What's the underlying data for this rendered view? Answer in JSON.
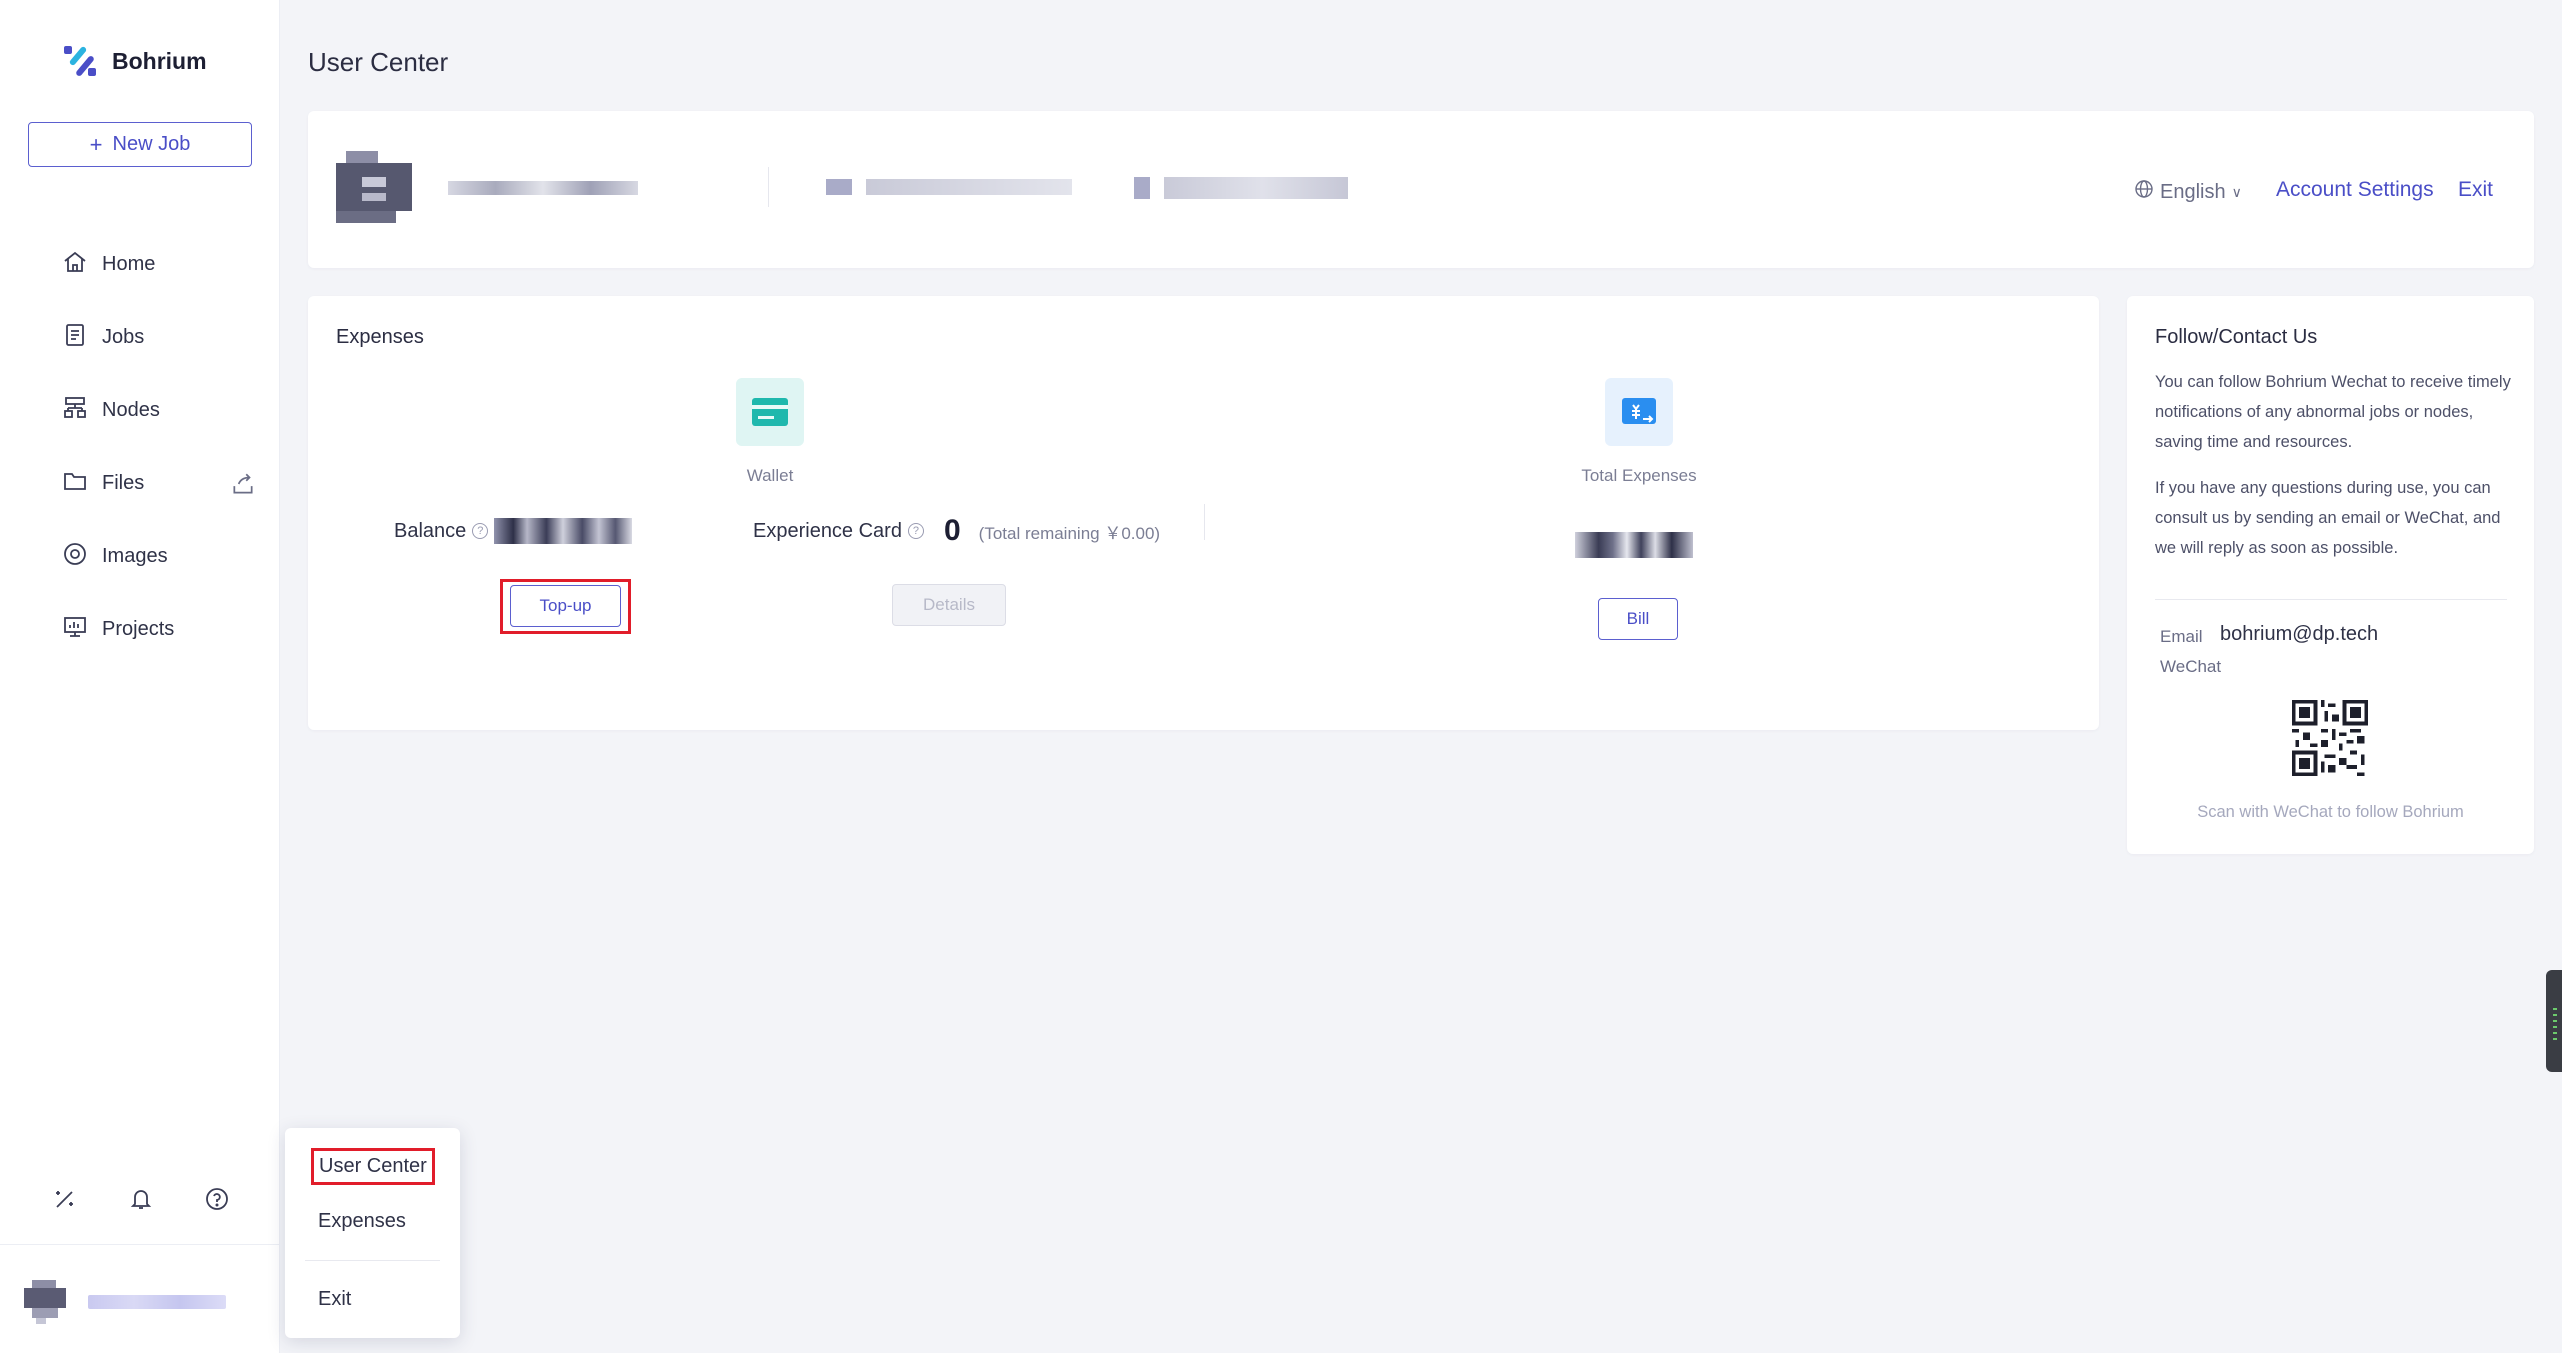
{
  "app": {
    "name": "Bohrium",
    "brand_color": "#4a4ec7",
    "highlight_color": "#e11d2a"
  },
  "sidebar": {
    "new_job_label": "New Job",
    "items": [
      {
        "label": "Home",
        "icon": "home-icon"
      },
      {
        "label": "Jobs",
        "icon": "jobs-icon"
      },
      {
        "label": "Nodes",
        "icon": "nodes-icon"
      },
      {
        "label": "Files",
        "icon": "folder-icon"
      },
      {
        "label": "Images",
        "icon": "images-icon"
      },
      {
        "label": "Projects",
        "icon": "projects-icon"
      }
    ],
    "bottom_icons": [
      "magic-wand-icon",
      "bell-icon",
      "help-circle-icon"
    ]
  },
  "popup_menu": {
    "items": [
      "User Center",
      "Expenses",
      "Exit"
    ],
    "selected": "User Center"
  },
  "header": {
    "page_title": "User Center",
    "language": "English",
    "account_settings_label": "Account Settings",
    "exit_label": "Exit"
  },
  "expenses": {
    "title": "Expenses",
    "wallet_caption": "Wallet",
    "balance_label": "Balance",
    "topup_label": "Top-up",
    "experience_card_label": "Experience Card",
    "experience_card_count": "0",
    "experience_card_remaining": "(Total remaining ￥0.00)",
    "details_label": "Details",
    "total_expenses_caption": "Total Expenses",
    "bill_label": "Bill"
  },
  "contact": {
    "title": "Follow/Contact Us",
    "paragraph1": "You can follow Bohrium Wechat to receive timely notifications of any abnormal jobs or nodes, saving time and resources.",
    "paragraph2": "If you have any questions during use, you can consult us by sending an email or WeChat, and we will reply as soon as possible.",
    "email_label": "Email",
    "email_value": "bohrium@dp.tech",
    "wechat_label": "WeChat",
    "scan_caption": "Scan with WeChat to follow Bohrium"
  }
}
